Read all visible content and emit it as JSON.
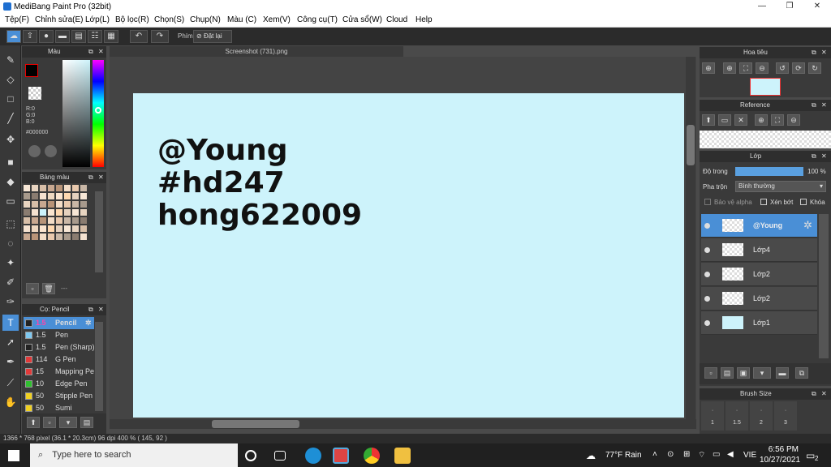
{
  "app": {
    "title": "MediBang Paint Pro (32bit)"
  },
  "window_controls": {
    "minimize": "—",
    "maximize": "❐",
    "close": "✕"
  },
  "menu": [
    "Tệp(F)",
    "Chỉnh sửa(E)",
    "Lớp(L)",
    "Bộ lọc(R)",
    "Chọn(S)",
    "Chụp(N)",
    "Màu (C)",
    "Xem(V)",
    "Công cụ(T)",
    "Cửa sổ(W)",
    "Cloud",
    "Help"
  ],
  "toolbar": {
    "phim_label": "Phím",
    "reset_label": "Đặt lại"
  },
  "document": {
    "tab_title": "Screenshot (731).png",
    "lines": [
      "@Young",
      "#hd247",
      "hong622009"
    ],
    "bg_color": "#cdf3fb"
  },
  "color_panel": {
    "title": "Màu",
    "r": "R:0",
    "g": "G:0",
    "b": "B:0",
    "hex": "#000000"
  },
  "palette_panel": {
    "title": "Bảng màu",
    "footer": "---"
  },
  "brush_panel": {
    "title": "Cọ: Pencil",
    "brushes": [
      {
        "size": "1.5",
        "name": "Pencil",
        "color": "#222222",
        "selected": true
      },
      {
        "size": "1.5",
        "name": "Pen",
        "color": "#7ec8f0",
        "selected": false
      },
      {
        "size": "1.5",
        "name": "Pen (Sharp)",
        "color": "#222222",
        "selected": false
      },
      {
        "size": "114",
        "name": "G Pen",
        "color": "#e23a3a",
        "selected": false
      },
      {
        "size": "15",
        "name": "Mapping Pen",
        "color": "#e23a3a",
        "selected": false
      },
      {
        "size": "10",
        "name": "Edge Pen",
        "color": "#2fbf2f",
        "selected": false
      },
      {
        "size": "50",
        "name": "Stipple Pen",
        "color": "#f0d020",
        "selected": false
      },
      {
        "size": "50",
        "name": "Sumi",
        "color": "#f0d020",
        "selected": false
      }
    ]
  },
  "navigator_panel": {
    "title": "Hoa tiêu"
  },
  "reference_panel": {
    "title": "Reference"
  },
  "layer_panel": {
    "title": "Lớp",
    "opacity_label": "Độ trong",
    "opacity_value": "100 %",
    "opacity_fraction": 1.0,
    "blend_label": "Pha trộn",
    "blend_value": "Bình thường",
    "protect_alpha": "Bảo vệ alpha",
    "clipping": "Xén bớt",
    "lock": "Khóa",
    "layers": [
      {
        "name": "@Young",
        "selected": true
      },
      {
        "name": "Lớp4",
        "selected": false
      },
      {
        "name": "Lớp2",
        "selected": false
      },
      {
        "name": "Lớp2",
        "selected": false
      },
      {
        "name": "Lớp1",
        "selected": false
      }
    ]
  },
  "brush_size_panel": {
    "title": "Brush Size",
    "sizes": [
      "1",
      "1.5",
      "2",
      "3"
    ]
  },
  "status": {
    "text": "1366 * 768 pixel   (36.1 * 20.3cm)   96 dpi   400 %   ( 145, 92 )"
  },
  "taskbar": {
    "search_placeholder": "Type here to search",
    "weather": "77°F  Rain",
    "lang": "VIE",
    "time": "6:56 PM",
    "date": "10/27/2021",
    "notifications": "2"
  },
  "colors": {
    "accent": "#4a8fd6",
    "panel": "#3a3a3a"
  }
}
